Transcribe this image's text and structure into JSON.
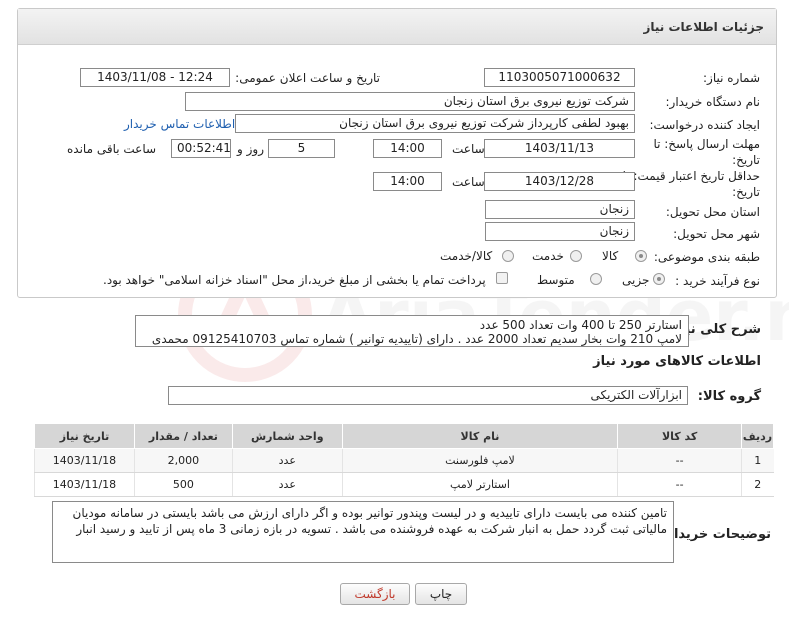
{
  "header": {
    "title": "جزئیات اطلاعات نیاز"
  },
  "form": {
    "need_number_label": "شماره نیاز:",
    "need_number": "1103005071000632",
    "announce_label": "تاریخ و ساعت اعلان عمومی:",
    "announce_value": "1403/11/08 - 12:24",
    "buyer_org_label": "نام دستگاه خریدار:",
    "buyer_org": "شرکت توزیع نیروی برق استان زنجان",
    "requester_label": "ایجاد کننده درخواست:",
    "requester": "بهبود لطفی کارپرداز شرکت توزیع نیروی برق استان زنجان",
    "contact_link": "اطلاعات تماس خریدار",
    "send_deadline_label": "مهلت ارسال پاسخ: تا تاریخ:",
    "send_date": "1403/11/13",
    "time_label": "ساعت",
    "send_time": "14:00",
    "days_value": "5",
    "days_label": "روز و",
    "remaining_time": "00:52:41",
    "remaining_label": "ساعت باقی مانده",
    "price_deadline_label": "حداقل تاریخ اعتبار قیمت: تا تاریخ:",
    "price_date": "1403/12/28",
    "price_time": "14:00",
    "province_label": "استان محل تحویل:",
    "province": "زنجان",
    "city_label": "شهر محل تحویل:",
    "city": "زنجان",
    "category_label": "طبقه بندی موضوعی:",
    "category_options": [
      "کالا",
      "خدمت",
      "کالا/خدمت"
    ],
    "category_selected": "کالا",
    "category_value": "کالا/خدمت",
    "process_label": "نوع فرآیند خرید :",
    "process_options": [
      "جزیی",
      "متوسط"
    ],
    "process_selected": "جزیی",
    "payment_note": "پرداخت تمام یا بخشی از مبلغ خرید،از محل \"اسناد خزانه اسلامی\" خواهد بود."
  },
  "need_desc": {
    "label": "شرح کلی نیاز:",
    "line1": "استارتر 250 تا 400  وات  تعداد 500 عدد",
    "line2": "لامپ 210 وات بخار سدیم  تعداد 2000 عدد . دارای (تاییدیه توانیر ) شماره تماس  09125410703 محمدی"
  },
  "goods": {
    "section_title": "اطلاعات کالاهای مورد نیاز",
    "group_label": "گروه کالا:",
    "group_value": "ابزارآلات الکتریکی",
    "columns": [
      "ردیف",
      "کد کالا",
      "نام کالا",
      "واحد شمارش",
      "تعداد / مقدار",
      "تاریخ نیاز"
    ],
    "rows": [
      [
        "1",
        "--",
        "لامپ فلورسنت",
        "عدد",
        "2,000",
        "1403/11/18"
      ],
      [
        "2",
        "--",
        "استارتر لامپ",
        "عدد",
        "500",
        "1403/11/18"
      ]
    ]
  },
  "buyer_notes": {
    "label": "توضیحات خریدار:",
    "text": "تامین کننده می بایست دارای تاییدیه و در لیست وپندور توانیر بوده و اگر دارای ارزش می باشد بایستی در سامانه مودیان مالیاتی ثبت گردد حمل به انبار شرکت به عهده فروشنده می باشد . تسویه در بازه زمانی 3 ماه پس از تایید و رسید انبار"
  },
  "buttons": {
    "print": "چاپ",
    "back": "بازگشت"
  },
  "watermark": {
    "text": "AriaTender.neT"
  },
  "colors": {
    "link": "#2060b0",
    "table_header": "#d6d6d6",
    "back_text": "#c0392b"
  }
}
